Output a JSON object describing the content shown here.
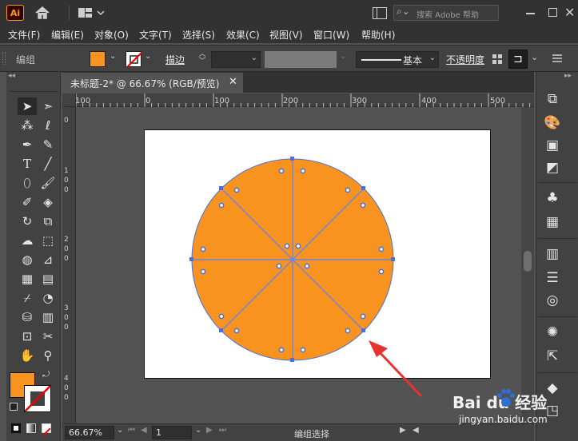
{
  "app": {
    "logo": "Ai",
    "search_placeholder": "搜索 Adobe 帮助",
    "icons": [
      "home-icon",
      "workspace-layout-icon",
      "search-icon",
      "minimize-icon",
      "maximize-icon",
      "close-icon"
    ]
  },
  "menu": {
    "items": [
      "文件(F)",
      "编辑(E)",
      "对象(O)",
      "文字(T)",
      "选择(S)",
      "效果(C)",
      "视图(V)",
      "窗口(W)",
      "帮助(H)"
    ]
  },
  "control_bar": {
    "selection_label": "编组",
    "stroke_label": "描边",
    "stroke_profile": "基本",
    "opacity_label": "不透明度"
  },
  "colors": {
    "fill": "#f7931e",
    "accent_selection": "#4a6fe0",
    "panel_bg": "#424242",
    "app_bg": "#323232",
    "canvas_bg": "#535353"
  },
  "document": {
    "tab_title": "未标题-2* @ 66.67% (RGB/预览)"
  },
  "ruler": {
    "h_ticks": [
      "100",
      "0",
      "100",
      "200",
      "300",
      "400",
      "500"
    ],
    "v_ticks": [
      "0",
      "1 0 0",
      "2 0 0",
      "3 0 0",
      "4 0 0"
    ]
  },
  "status": {
    "zoom": "66.67%",
    "artboard": "1",
    "mode": "编组选择"
  },
  "watermark": {
    "brand": "Bai du 经验",
    "url": "jingyan.baidu.com"
  }
}
